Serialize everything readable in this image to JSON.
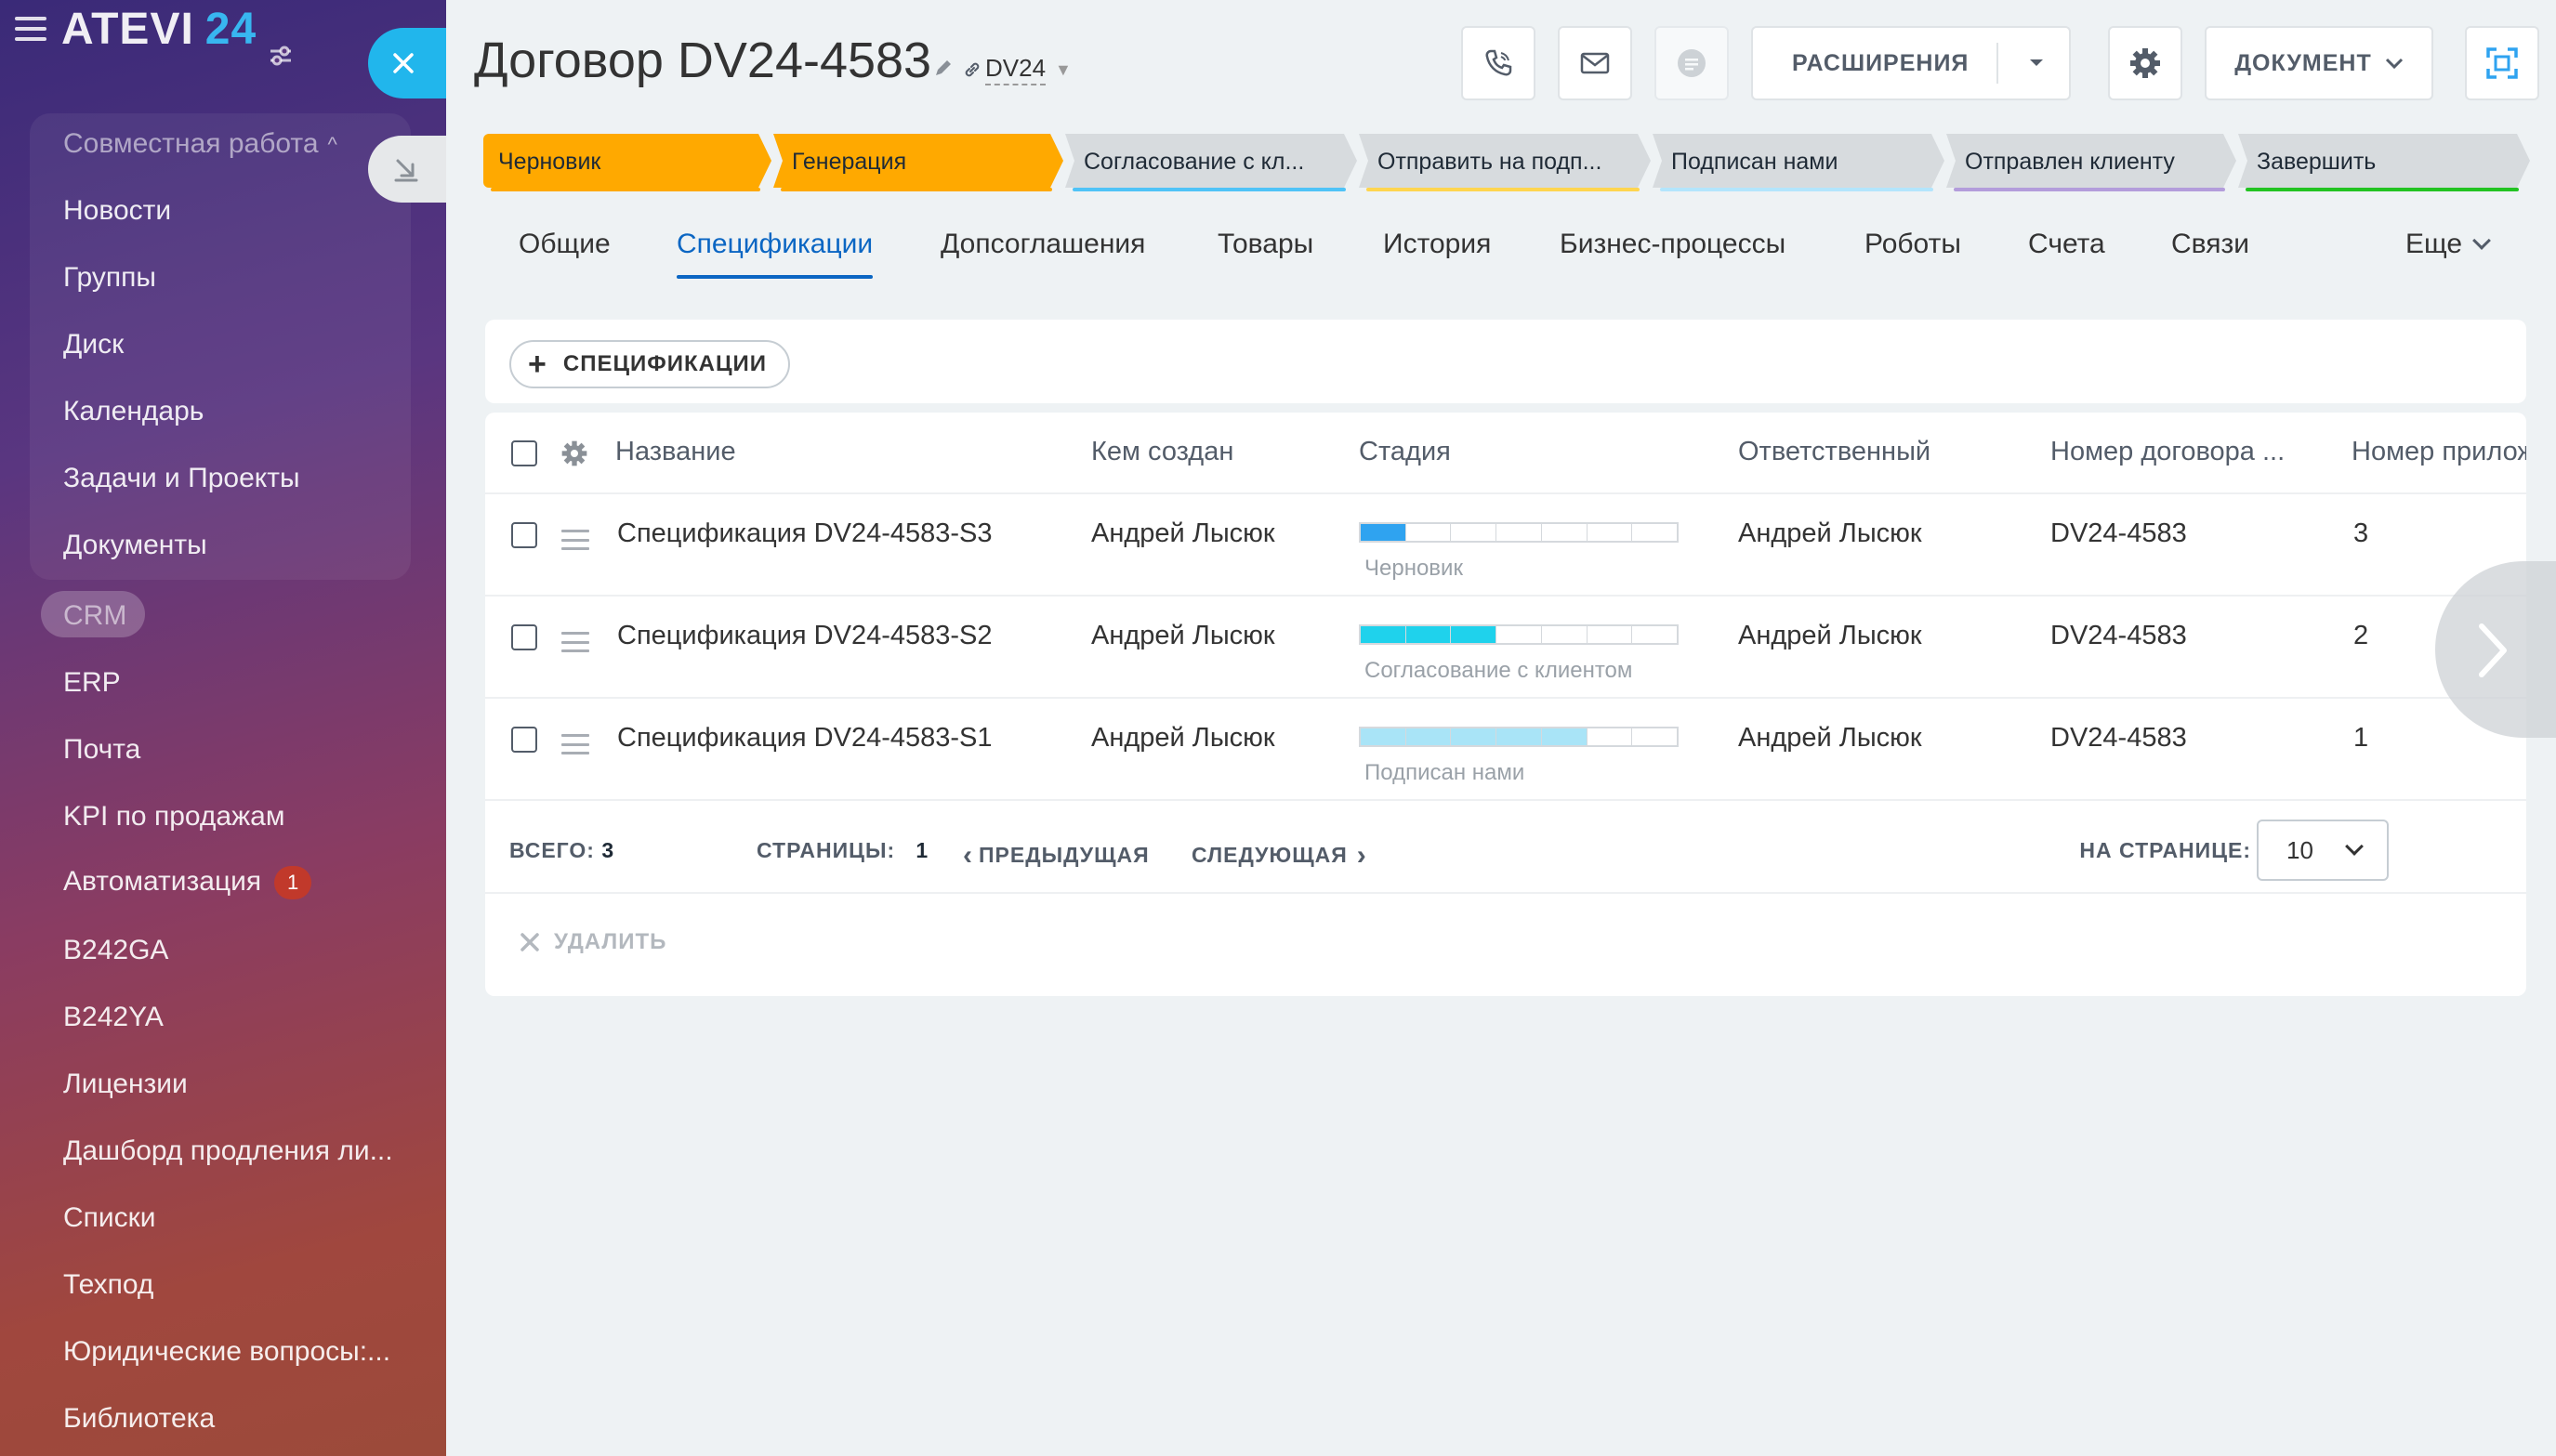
{
  "sidebar": {
    "logo_text": "ATEVI",
    "logo_num": "24",
    "items": [
      {
        "label": "Совместная работа",
        "dim": true
      },
      {
        "label": "Новости"
      },
      {
        "label": "Группы"
      },
      {
        "label": "Диск"
      },
      {
        "label": "Календарь"
      },
      {
        "label": "Задачи и Проекты"
      },
      {
        "label": "Документы"
      },
      {
        "label": "CRM",
        "dim": true
      },
      {
        "label": "ERP"
      },
      {
        "label": "Почта"
      },
      {
        "label": "KPI по продажам"
      },
      {
        "label": "Автоматизация",
        "badge": "1"
      },
      {
        "label": "B242GA"
      },
      {
        "label": "B242YA"
      },
      {
        "label": "Лицензии"
      },
      {
        "label": "Дашборд продления ли..."
      },
      {
        "label": "Списки"
      },
      {
        "label": "Техпод"
      },
      {
        "label": "Юридические вопросы:..."
      },
      {
        "label": "Библиотека"
      }
    ]
  },
  "header": {
    "title": "Договор DV24-4583",
    "tag": "DV24",
    "extensions_label": "РАСШИРЕНИЯ",
    "document_label": "ДОКУМЕНТ"
  },
  "stages": [
    {
      "label": "Черновик",
      "active": true,
      "color": "#ffa900"
    },
    {
      "label": "Генерация",
      "active": true,
      "color": "#ffa900"
    },
    {
      "label": "Согласование с кл...",
      "active": false,
      "color": "#4fc3f7"
    },
    {
      "label": "Отправить на подп...",
      "active": false,
      "color": "#ffd54f"
    },
    {
      "label": "Подписан нами",
      "active": false,
      "color": "#b3e5fc"
    },
    {
      "label": "Отправлен клиенту",
      "active": false,
      "color": "#b39ddb"
    },
    {
      "label": "Завершить",
      "active": false,
      "color": "#22c322"
    }
  ],
  "tabs": [
    {
      "label": "Общие"
    },
    {
      "label": "Спецификации",
      "active": true
    },
    {
      "label": "Допсоглашения"
    },
    {
      "label": "Товары"
    },
    {
      "label": "История"
    },
    {
      "label": "Бизнес-процессы"
    },
    {
      "label": "Роботы"
    },
    {
      "label": "Счета"
    },
    {
      "label": "Связи"
    },
    {
      "label": "Еще"
    }
  ],
  "add_button_label": "СПЕЦИФИКАЦИИ",
  "grid": {
    "columns": [
      "Название",
      "Кем создан",
      "Стадия",
      "Ответственный",
      "Номер договора ...",
      "Номер прилож"
    ],
    "rows": [
      {
        "name": "Спецификация DV24-4583-S3",
        "created_by": "Андрей Лысюк",
        "stage": "Черновик",
        "progress_segments": 1,
        "stage_color": "#2fa3f0",
        "responsible": "Андрей Лысюк",
        "contract_number": "DV24-4583",
        "appendix_number": "3"
      },
      {
        "name": "Спецификация DV24-4583-S2",
        "created_by": "Андрей Лысюк",
        "stage": "Согласование с клиентом",
        "progress_segments": 3,
        "stage_color": "#1fd2ec",
        "responsible": "Андрей Лысюк",
        "contract_number": "DV24-4583",
        "appendix_number": "2"
      },
      {
        "name": "Спецификация DV24-4583-S1",
        "created_by": "Андрей Лысюк",
        "stage": "Подписан нами",
        "progress_segments": 5,
        "stage_color": "#a9e4f7",
        "responsible": "Андрей Лысюк",
        "contract_number": "DV24-4583",
        "appendix_number": "1"
      }
    ],
    "progress_total_segments": 7
  },
  "footer": {
    "total_label": "ВСЕГО:",
    "total_value": "3",
    "pages_label": "СТРАНИЦЫ:",
    "pages_value": "1",
    "prev_label": "ПРЕДЫДУЩАЯ",
    "next_label": "СЛЕДУЮЩАЯ",
    "per_page_label": "НА СТРАНИЦЕ:",
    "per_page_value": "10",
    "delete_label": "УДАЛИТЬ"
  }
}
